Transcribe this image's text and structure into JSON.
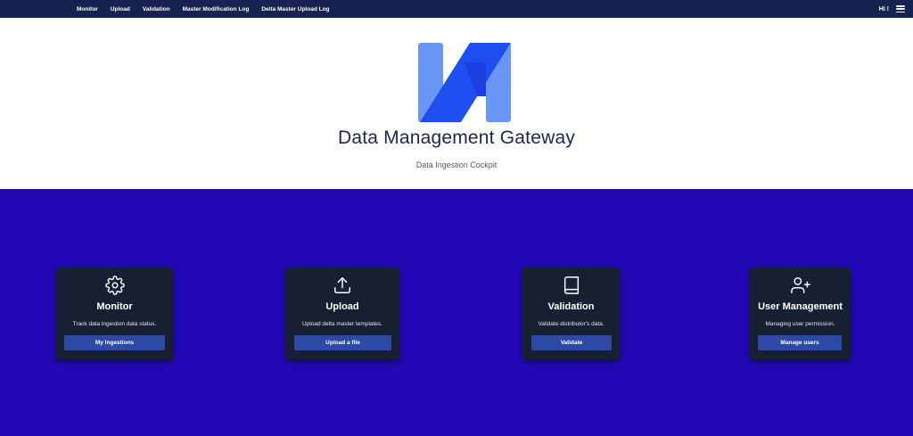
{
  "nav": {
    "items": [
      "Monitor",
      "Upload",
      "Validation",
      "Master Modification Log",
      "Delta Master Upload Log"
    ],
    "greeting": "Hi !"
  },
  "hero": {
    "title": "Data Management Gateway",
    "subtitle": "Data Ingestion Cockpit"
  },
  "cards": [
    {
      "icon": "gear-icon",
      "title": "Monitor",
      "description": "Track data ingestion data status.",
      "button": "My Ingestions"
    },
    {
      "icon": "upload-icon",
      "title": "Upload",
      "description": "Upload delta master templates.",
      "button": "Upload a file"
    },
    {
      "icon": "book-icon",
      "title": "Validation",
      "description": "Validate distributor's data.",
      "button": "Validate"
    },
    {
      "icon": "user-plus-icon",
      "title": "User Management",
      "description": "Managing user permission.",
      "button": "Manage users"
    }
  ],
  "colors": {
    "topbar": "#16224f",
    "main_background": "#2309b6",
    "card_background": "#171f33",
    "button": "#2c4aa3",
    "logo_light": "#6a96f8",
    "logo_dark": "#1e4ef0"
  }
}
